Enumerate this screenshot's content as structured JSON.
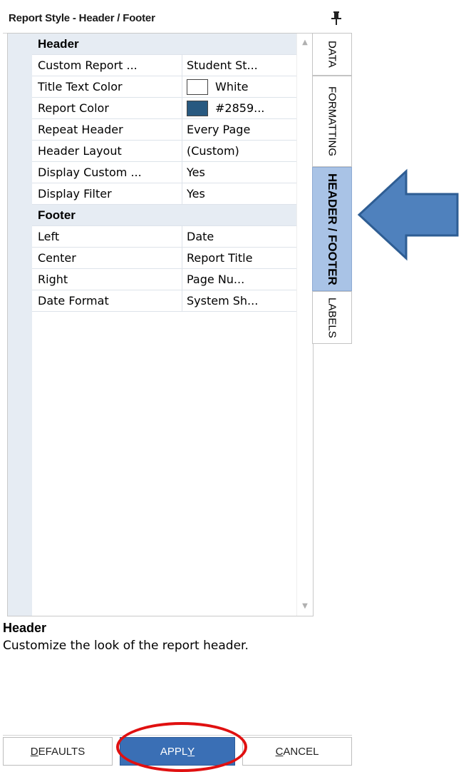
{
  "panel": {
    "title": "Report Style - Header / Footer"
  },
  "grid": {
    "categories": [
      {
        "label": "Header",
        "rows": [
          {
            "name": "Custom Report ...",
            "value": "Student St..."
          },
          {
            "name": "Title Text Color",
            "value": "White",
            "swatch": "#ffffff"
          },
          {
            "name": "Report Color",
            "value": "#2859...",
            "swatch": "#285980"
          },
          {
            "name": "Repeat Header",
            "value": "Every Page"
          },
          {
            "name": "Header Layout",
            "value": "(Custom)"
          },
          {
            "name": "Display Custom ...",
            "value": "Yes"
          },
          {
            "name": "Display Filter",
            "value": "Yes"
          }
        ]
      },
      {
        "label": "Footer",
        "rows": [
          {
            "name": "Left",
            "value": "Date"
          },
          {
            "name": "Center",
            "value": "Report Title"
          },
          {
            "name": "Right",
            "value": "Page Nu..."
          },
          {
            "name": "Date Format",
            "value": "System Sh..."
          }
        ]
      }
    ]
  },
  "description": {
    "title": "Header",
    "body": "Customize the look of the report header."
  },
  "buttons": {
    "defaults": {
      "first": "D",
      "rest": "EFAULTS"
    },
    "apply": {
      "pre": "APPL",
      "u": "Y"
    },
    "cancel": {
      "first": "C",
      "rest": "ANCEL"
    }
  },
  "tabs": [
    {
      "label": "DATA",
      "active": false
    },
    {
      "label": "FORMATTING",
      "active": false
    },
    {
      "label": "HEADER / FOOTER",
      "active": true
    },
    {
      "label": "LABELS",
      "active": false
    }
  ],
  "colors": {
    "active_tab": "#a9c3e6",
    "apply_button": "#3a6fb5",
    "arrow": "#4f81bd",
    "highlight": "#e01010"
  }
}
